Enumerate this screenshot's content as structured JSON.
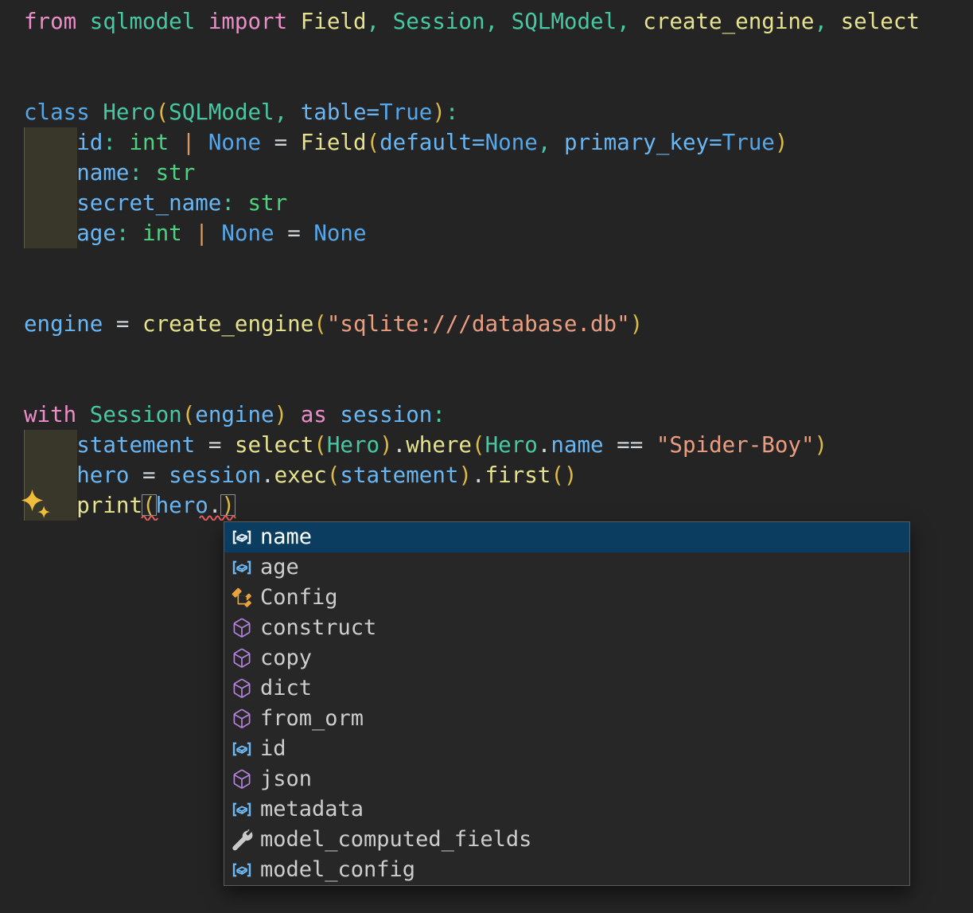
{
  "editor": {
    "background": "#242424",
    "sparkle_icon": "copilot-sparkles",
    "lines": [
      {
        "n": 1,
        "tokens": [
          [
            "kw",
            "from"
          ],
          [
            "pl",
            " "
          ],
          [
            "typ",
            "sqlmodel"
          ],
          [
            "pl",
            " "
          ],
          [
            "kw",
            "import"
          ],
          [
            "pl",
            " "
          ],
          [
            "fn",
            "Field"
          ],
          [
            "pun",
            ","
          ],
          [
            "pl",
            " "
          ],
          [
            "typ",
            "Session"
          ],
          [
            "pun",
            ","
          ],
          [
            "pl",
            " "
          ],
          [
            "typ",
            "SQLModel"
          ],
          [
            "pun",
            ","
          ],
          [
            "pl",
            " "
          ],
          [
            "fn",
            "create_engine"
          ],
          [
            "pun",
            ","
          ],
          [
            "pl",
            " "
          ],
          [
            "fn",
            "select"
          ]
        ]
      },
      {
        "n": 4,
        "tokens": [
          [
            "blue",
            "class"
          ],
          [
            "pl",
            " "
          ],
          [
            "typ",
            "Hero"
          ],
          [
            "br",
            "("
          ],
          [
            "typ",
            "SQLModel"
          ],
          [
            "pun",
            ","
          ],
          [
            "pl",
            " "
          ],
          [
            "id",
            "table"
          ],
          [
            "id",
            "="
          ],
          [
            "blue",
            "True"
          ],
          [
            "br",
            ")"
          ],
          [
            "pun",
            ":"
          ]
        ]
      },
      {
        "n": 5,
        "tokens": [
          [
            "pl",
            "    "
          ],
          [
            "id",
            "id"
          ],
          [
            "pun",
            ":"
          ],
          [
            "pl",
            " "
          ],
          [
            "grn",
            "int"
          ],
          [
            "pl",
            " "
          ],
          [
            "pipe",
            "|"
          ],
          [
            "pl",
            " "
          ],
          [
            "blue",
            "None"
          ],
          [
            "pl",
            " "
          ],
          [
            "op",
            "="
          ],
          [
            "pl",
            " "
          ],
          [
            "fn",
            "Field"
          ],
          [
            "br",
            "("
          ],
          [
            "id",
            "default"
          ],
          [
            "id",
            "="
          ],
          [
            "blue",
            "None"
          ],
          [
            "pun",
            ","
          ],
          [
            "pl",
            " "
          ],
          [
            "id",
            "primary_key"
          ],
          [
            "id",
            "="
          ],
          [
            "blue",
            "True"
          ],
          [
            "br",
            ")"
          ]
        ]
      },
      {
        "n": 6,
        "tokens": [
          [
            "pl",
            "    "
          ],
          [
            "id",
            "name"
          ],
          [
            "pun",
            ":"
          ],
          [
            "pl",
            " "
          ],
          [
            "grn",
            "str"
          ]
        ]
      },
      {
        "n": 7,
        "tokens": [
          [
            "pl",
            "    "
          ],
          [
            "id",
            "secret_name"
          ],
          [
            "pun",
            ":"
          ],
          [
            "pl",
            " "
          ],
          [
            "grn",
            "str"
          ]
        ]
      },
      {
        "n": 8,
        "tokens": [
          [
            "pl",
            "    "
          ],
          [
            "id",
            "age"
          ],
          [
            "pun",
            ":"
          ],
          [
            "pl",
            " "
          ],
          [
            "grn",
            "int"
          ],
          [
            "pl",
            " "
          ],
          [
            "pipe",
            "|"
          ],
          [
            "pl",
            " "
          ],
          [
            "blue",
            "None"
          ],
          [
            "pl",
            " "
          ],
          [
            "op",
            "="
          ],
          [
            "pl",
            " "
          ],
          [
            "blue",
            "None"
          ]
        ]
      },
      {
        "n": 11,
        "tokens": [
          [
            "id",
            "engine"
          ],
          [
            "pl",
            " "
          ],
          [
            "op",
            "="
          ],
          [
            "pl",
            " "
          ],
          [
            "fn",
            "create_engine"
          ],
          [
            "br",
            "("
          ],
          [
            "str",
            "\"sqlite:///database.db\""
          ],
          [
            "br",
            ")"
          ]
        ]
      },
      {
        "n": 14,
        "tokens": [
          [
            "kw",
            "with"
          ],
          [
            "pl",
            " "
          ],
          [
            "typ",
            "Session"
          ],
          [
            "br",
            "("
          ],
          [
            "id",
            "engine"
          ],
          [
            "br",
            ")"
          ],
          [
            "pl",
            " "
          ],
          [
            "kw",
            "as"
          ],
          [
            "pl",
            " "
          ],
          [
            "id",
            "session"
          ],
          [
            "pun",
            ":"
          ]
        ]
      },
      {
        "n": 15,
        "tokens": [
          [
            "pl",
            "    "
          ],
          [
            "id",
            "statement"
          ],
          [
            "pl",
            " "
          ],
          [
            "op",
            "="
          ],
          [
            "pl",
            " "
          ],
          [
            "fn",
            "select"
          ],
          [
            "br",
            "("
          ],
          [
            "typ",
            "Hero"
          ],
          [
            "br",
            ")"
          ],
          [
            "dot",
            "."
          ],
          [
            "fn",
            "where"
          ],
          [
            "br",
            "("
          ],
          [
            "typ",
            "Hero"
          ],
          [
            "dot",
            "."
          ],
          [
            "id",
            "name"
          ],
          [
            "pl",
            " "
          ],
          [
            "op",
            "=="
          ],
          [
            "pl",
            " "
          ],
          [
            "str",
            "\"Spider-Boy\""
          ],
          [
            "br",
            ")"
          ]
        ]
      },
      {
        "n": 16,
        "tokens": [
          [
            "pl",
            "    "
          ],
          [
            "id",
            "hero"
          ],
          [
            "pl",
            " "
          ],
          [
            "op",
            "="
          ],
          [
            "pl",
            " "
          ],
          [
            "id",
            "session"
          ],
          [
            "dot",
            "."
          ],
          [
            "fn",
            "exec"
          ],
          [
            "br",
            "("
          ],
          [
            "id",
            "statement"
          ],
          [
            "br",
            ")"
          ],
          [
            "dot",
            "."
          ],
          [
            "fn",
            "first"
          ],
          [
            "br",
            "("
          ],
          [
            "br",
            ")"
          ]
        ]
      },
      {
        "n": 17,
        "tokens": [
          [
            "pl",
            "    "
          ],
          [
            "fn",
            "print"
          ],
          [
            "brx",
            "("
          ],
          [
            "id",
            "hero"
          ],
          [
            "dot",
            "."
          ],
          [
            "brx",
            ")"
          ]
        ]
      }
    ]
  },
  "suggest": {
    "selected_index": 0,
    "items": [
      {
        "label": "name",
        "kind": "field",
        "selected": true
      },
      {
        "label": "age",
        "kind": "field"
      },
      {
        "label": "Config",
        "kind": "class"
      },
      {
        "label": "construct",
        "kind": "method"
      },
      {
        "label": "copy",
        "kind": "method"
      },
      {
        "label": "dict",
        "kind": "method"
      },
      {
        "label": "from_orm",
        "kind": "method"
      },
      {
        "label": "id",
        "kind": "field"
      },
      {
        "label": "json",
        "kind": "method"
      },
      {
        "label": "metadata",
        "kind": "field"
      },
      {
        "label": "model_computed_fields",
        "kind": "property"
      },
      {
        "label": "model_config",
        "kind": "field"
      }
    ]
  },
  "colors": {
    "background": "#242424",
    "keyword_pink": "#ec8cc8",
    "keyword_blue": "#55a7ea",
    "class_teal": "#46c8a2",
    "builtin_green": "#4fd27f",
    "identifier_blue": "#68b6f3",
    "function_yellow": "#e6e28e",
    "string_salmon": "#eb9d80",
    "bracket_gold": "#dcba45",
    "operator_silver": "#ccd4da",
    "pipe_orange": "#d79a62",
    "error_red": "#e85d5d",
    "selection_blue": "#0b3d61",
    "indent_highlight": "#38372a",
    "icon_field_blue": "#6cb8f5",
    "icon_method_purple": "#b180d7",
    "icon_class_orange": "#e8a33d",
    "icon_property_gray": "#c9c9c9",
    "sparkle_gold": "#f0bd3a"
  }
}
